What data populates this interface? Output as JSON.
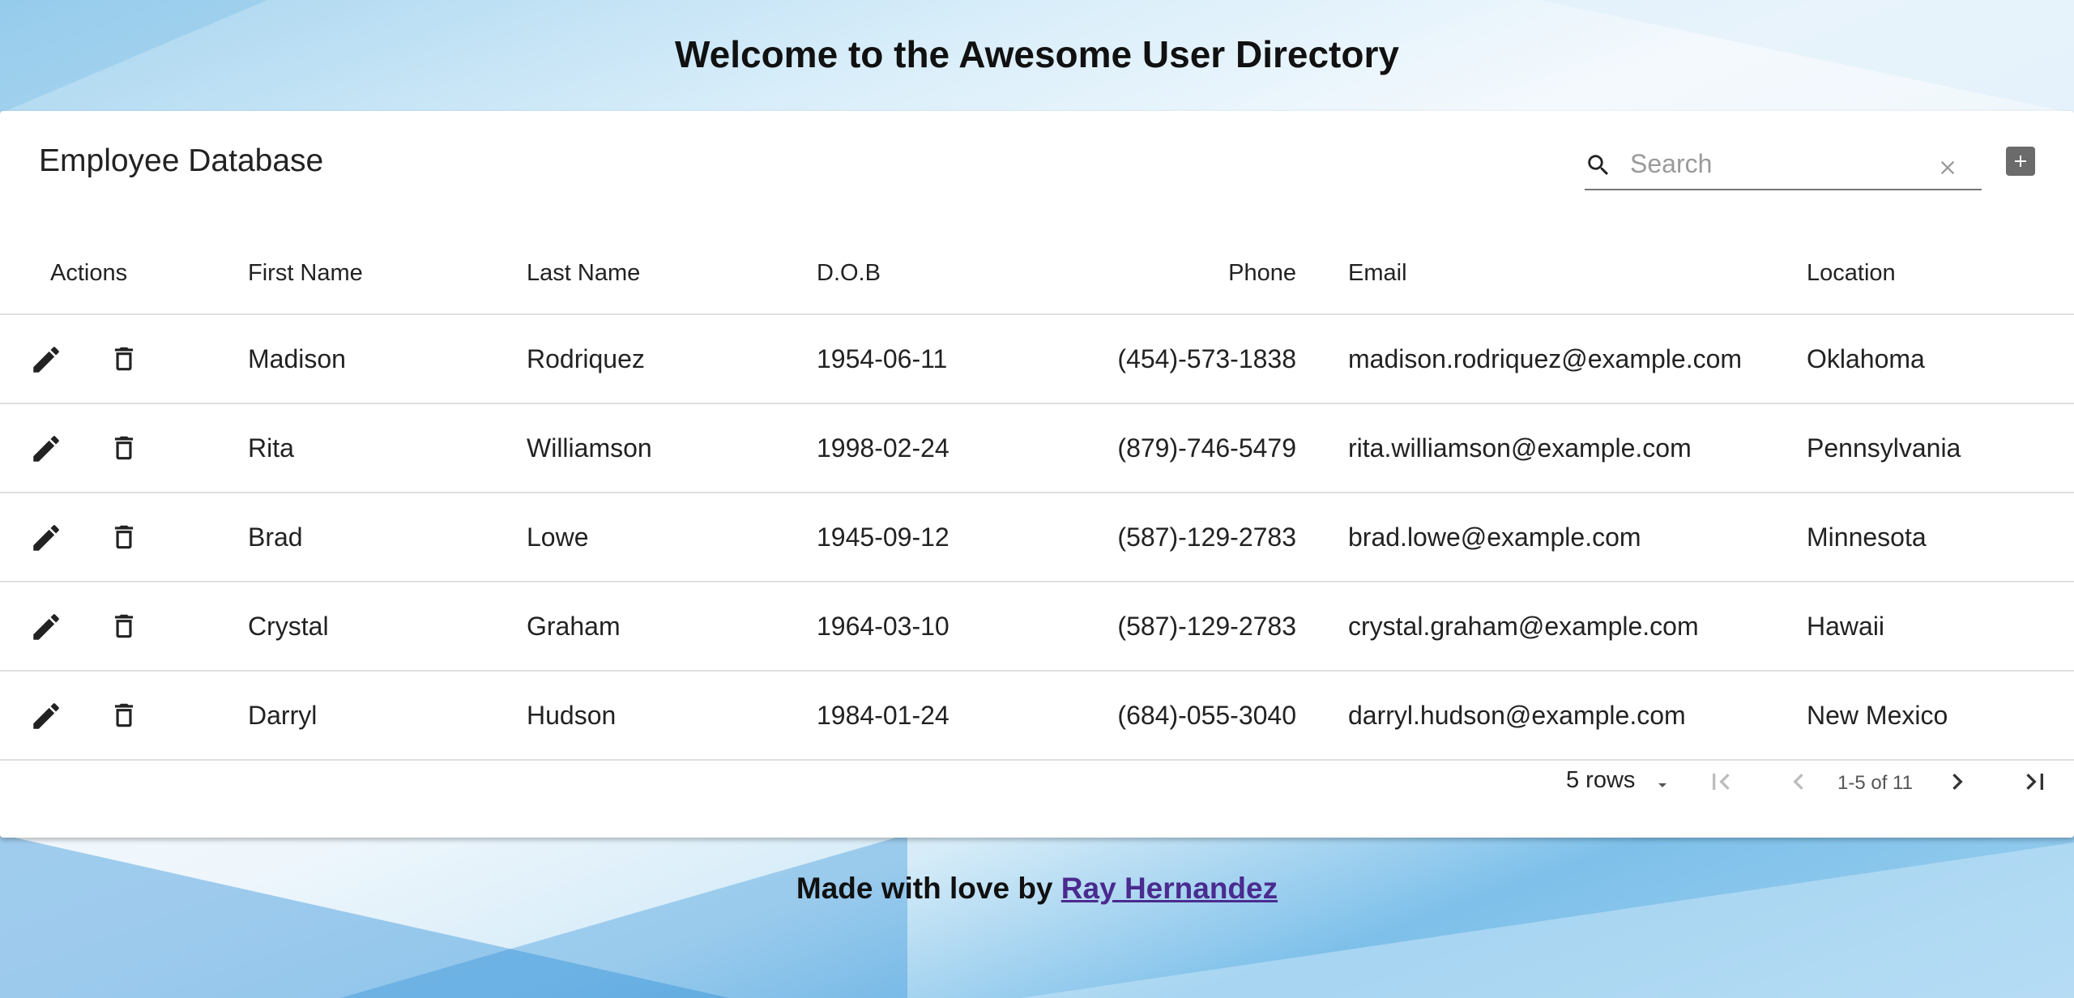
{
  "header": {
    "title": "Welcome to the Awesome User Directory"
  },
  "card": {
    "title": "Employee Database",
    "search": {
      "placeholder": "Search",
      "value": ""
    }
  },
  "table": {
    "columns": [
      "Actions",
      "First Name",
      "Last Name",
      "D.O.B",
      "Phone",
      "Email",
      "Location"
    ],
    "rows": [
      {
        "first": "Madison",
        "last": "Rodriquez",
        "dob": "1954-06-11",
        "phone": "(454)-573-1838",
        "email": "madison.rodriquez@example.com",
        "location": "Oklahoma"
      },
      {
        "first": "Rita",
        "last": "Williamson",
        "dob": "1998-02-24",
        "phone": "(879)-746-5479",
        "email": "rita.williamson@example.com",
        "location": "Pennsylvania"
      },
      {
        "first": "Brad",
        "last": "Lowe",
        "dob": "1945-09-12",
        "phone": "(587)-129-2783",
        "email": "brad.lowe@example.com",
        "location": "Minnesota"
      },
      {
        "first": "Crystal",
        "last": "Graham",
        "dob": "1964-03-10",
        "phone": "(587)-129-2783",
        "email": "crystal.graham@example.com",
        "location": "Hawaii"
      },
      {
        "first": "Darryl",
        "last": "Hudson",
        "dob": "1984-01-24",
        "phone": "(684)-055-3040",
        "email": "darryl.hudson@example.com",
        "location": "New Mexico"
      }
    ]
  },
  "pagination": {
    "rows_label": "5 rows",
    "range_label": "1-5 of 11"
  },
  "footer": {
    "prefix": "Made with love by ",
    "author": "Ray Hernandez"
  },
  "colors": {
    "link": "#4a2b8f",
    "icon": "#222222",
    "add_button": "#6b6b6b"
  }
}
